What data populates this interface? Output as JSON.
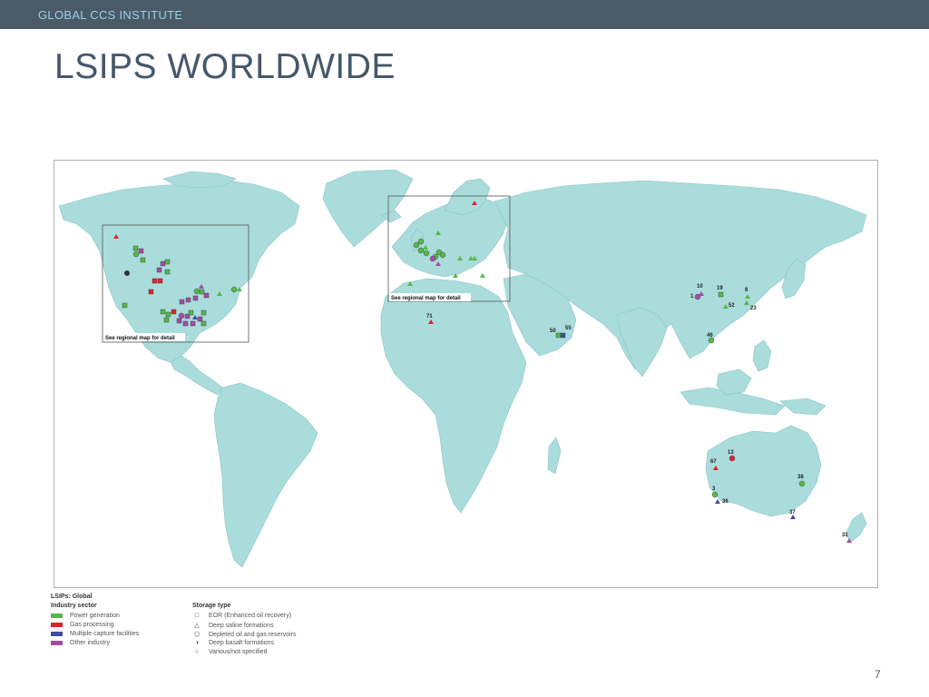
{
  "header": {
    "org": "GLOBAL CCS INSTITUTE"
  },
  "title": "LSIPS WORLDWIDE",
  "map": {
    "inset_labels": [
      "See regional map for detail",
      "See regional map for detail"
    ],
    "project_labels": [
      {
        "id": "10",
        "sector": "Other industry",
        "storage": "EOR"
      },
      {
        "id": "19",
        "sector": "Power generation",
        "storage": "EOR"
      },
      {
        "id": "8",
        "sector": "Power generation",
        "storage": "Deep saline formations"
      },
      {
        "id": "1",
        "sector": "Other industry",
        "storage": "Various/not specified"
      },
      {
        "id": "52",
        "sector": "Power generation",
        "storage": "Deep saline formations"
      },
      {
        "id": "23",
        "sector": "Power generation",
        "storage": "Deep saline formations"
      },
      {
        "id": "46",
        "sector": "Power generation",
        "storage": "Various/not specified"
      },
      {
        "id": "71",
        "sector": "Gas processing",
        "storage": "Deep saline formations"
      },
      {
        "id": "50",
        "sector": "Power generation",
        "storage": "EOR"
      },
      {
        "id": "55",
        "sector": "Multiple capture facilities",
        "storage": "EOR"
      },
      {
        "id": "13",
        "sector": "Gas processing",
        "storage": "Various/not specified"
      },
      {
        "id": "67",
        "sector": "Gas processing",
        "storage": "Deep saline formations"
      },
      {
        "id": "38",
        "sector": "Power generation",
        "storage": "Various/not specified"
      },
      {
        "id": "3",
        "sector": "Power generation",
        "storage": "Various/not specified"
      },
      {
        "id": "36",
        "sector": "Multiple capture facilities",
        "storage": "Deep saline formations"
      },
      {
        "id": "37",
        "sector": "Multiple capture facilities",
        "storage": "Deep saline formations"
      },
      {
        "id": "31",
        "sector": "Other industry",
        "storage": "Deep saline formations"
      }
    ]
  },
  "legend": {
    "title": "LSIPs: Global",
    "sector_heading": "Industry sector",
    "storage_heading": "Storage type",
    "sectors": [
      {
        "label": "Power generation",
        "color": "#55b84a"
      },
      {
        "label": "Gas processing",
        "color": "#d9262e"
      },
      {
        "label": "Multiple capture facilities",
        "color": "#3b4da0"
      },
      {
        "label": "Other industry",
        "color": "#a34ea5"
      }
    ],
    "storage": [
      {
        "label": "EOR (Enhanced oil recovery)",
        "glyph": "□"
      },
      {
        "label": "Deep saline formations",
        "glyph": "△"
      },
      {
        "label": "Depleted oil and gas reservoirs",
        "glyph": "⬠"
      },
      {
        "label": "Deep basalt formations",
        "glyph": "◑"
      },
      {
        "label": "Various/not specified",
        "glyph": "○"
      }
    ]
  },
  "page_number": "7",
  "colors": {
    "topbar": "#4a5a66",
    "land": "#aadcdc",
    "borders": "#7fb3b3",
    "title": "#45576a"
  }
}
